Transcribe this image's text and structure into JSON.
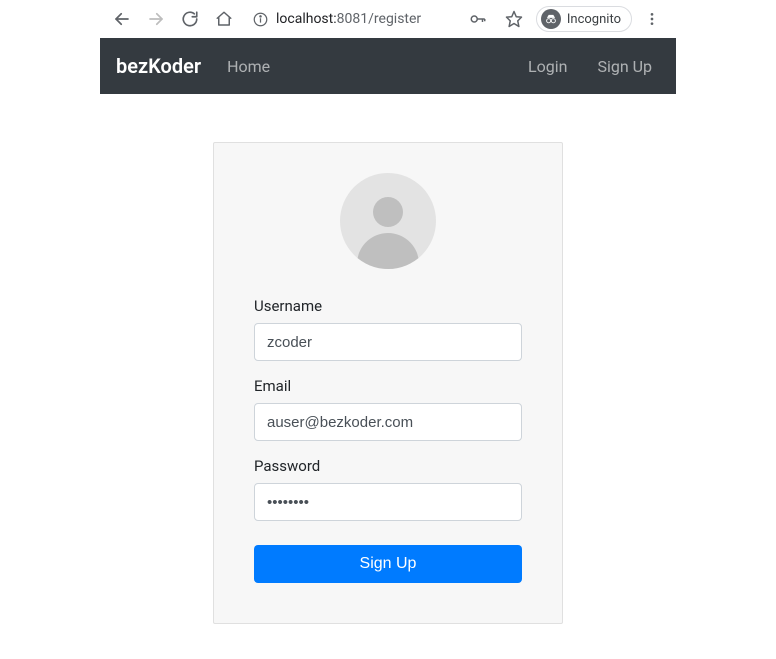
{
  "browser": {
    "url_host": "localhost:",
    "url_port": "8081",
    "url_path": "/register",
    "incognito_label": "Incognito"
  },
  "navbar": {
    "brand": "bezKoder",
    "links": {
      "home": "Home",
      "login": "Login",
      "signup": "Sign Up"
    }
  },
  "form": {
    "username_label": "Username",
    "username_value": "zcoder",
    "email_label": "Email",
    "email_value": "auser@bezkoder.com",
    "password_label": "Password",
    "password_value": "••••••••",
    "submit_label": "Sign Up"
  }
}
